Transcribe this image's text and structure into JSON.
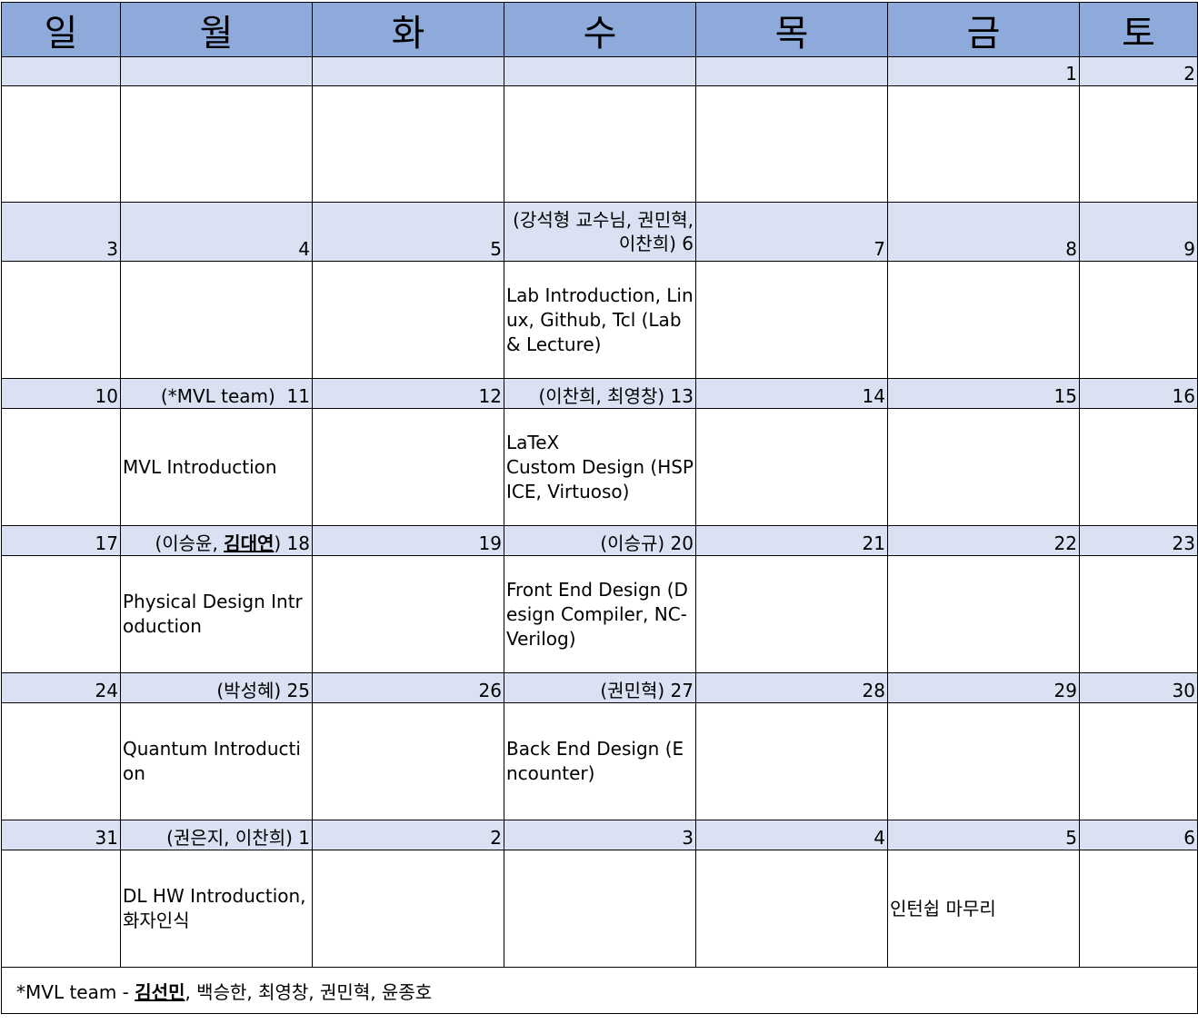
{
  "weekdays": [
    "일",
    "월",
    "화",
    "수",
    "목",
    "금",
    "토"
  ],
  "weeks": [
    {
      "dates": [
        "",
        "",
        "",
        "",
        "",
        "1",
        "2"
      ],
      "notes": [
        "",
        "",
        "",
        "",
        "",
        "",
        ""
      ],
      "events": [
        "",
        "",
        "",
        "",
        "",
        "",
        ""
      ]
    },
    {
      "dates": [
        "3",
        "4",
        "5",
        "6",
        "7",
        "8",
        "9"
      ],
      "notes": [
        "",
        "",
        "",
        "(강석형 교수님, 권민혁, 이찬희)",
        "",
        "",
        ""
      ],
      "events": [
        "",
        "",
        "",
        "Lab Introduction, Linux, Github, Tcl (Lab & Lecture)",
        "",
        "",
        ""
      ]
    },
    {
      "dates": [
        "10",
        "11",
        "12",
        "13",
        "14",
        "15",
        "16"
      ],
      "notes": [
        "",
        "(*MVL team)",
        "",
        "(이찬희, 최영창)",
        "",
        "",
        ""
      ],
      "events": [
        "",
        "MVL Introduction",
        "",
        "LaTeX\nCustom Design (HSPICE, Virtuoso)",
        "",
        "",
        ""
      ]
    },
    {
      "dates": [
        "17",
        "18",
        "19",
        "20",
        "21",
        "22",
        "23"
      ],
      "notes": [
        "",
        "(이승윤, |김대연|)",
        "",
        "(이승규)",
        "",
        "",
        ""
      ],
      "note_parts_18": {
        "pre": "(이승윤, ",
        "bold": "김대연",
        "post": ")"
      },
      "events": [
        "",
        "Physical Design Introduction",
        "",
        "Front End Design (Design Compiler, NC-Verilog)",
        "",
        "",
        ""
      ]
    },
    {
      "dates": [
        "24",
        "25",
        "26",
        "27",
        "28",
        "29",
        "30"
      ],
      "notes": [
        "",
        "(박성혜)",
        "",
        "(권민혁)",
        "",
        "",
        ""
      ],
      "events": [
        "",
        "Quantum Introduction",
        "",
        "Back End Design (Encounter)",
        "",
        "",
        ""
      ]
    },
    {
      "dates": [
        "31",
        "1",
        "2",
        "3",
        "4",
        "5",
        "6"
      ],
      "notes": [
        "",
        "(권은지, 이찬희)",
        "",
        "",
        "",
        "",
        ""
      ],
      "events": [
        "",
        "DL HW Introduction, 화자인식",
        "",
        "",
        "",
        "인턴쉽 마무리",
        ""
      ]
    }
  ],
  "footer": {
    "prefix": "*MVL team - ",
    "lead": "김선민",
    "rest": ", 백승한, 최영창, 권민혁, 윤종호"
  },
  "colors": {
    "header_bg": "#8eaadb",
    "date_row_bg": "#d9e1f2"
  }
}
